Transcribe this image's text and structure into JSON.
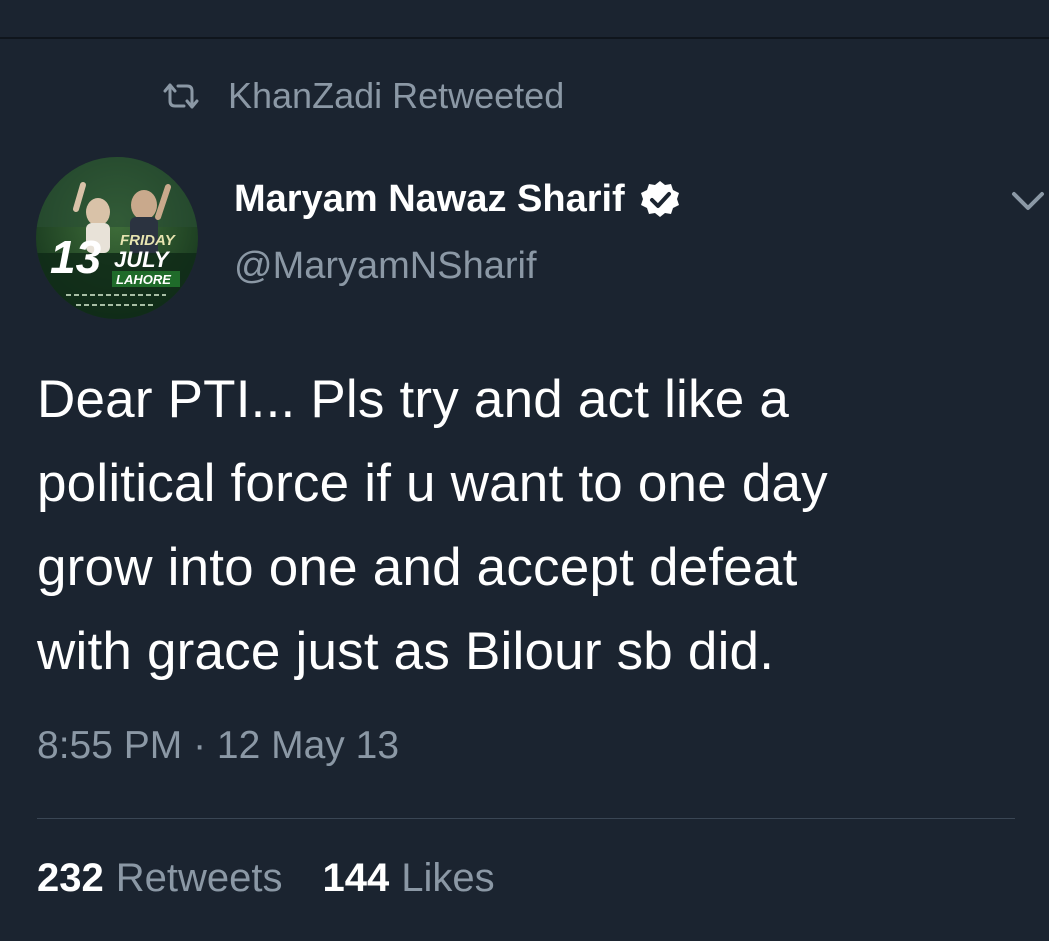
{
  "retweet_context": {
    "icon": "retweet-icon",
    "text": "KhanZadi Retweeted"
  },
  "author": {
    "avatar_badge": {
      "number": "13",
      "line1": "FRIDAY",
      "line2": "JULY",
      "line3": "LAHORE"
    },
    "name": "Maryam Nawaz Sharif",
    "verified_icon": "verified-badge-icon",
    "handle": "@MaryamNSharif"
  },
  "menu_icon": "chevron-down-icon",
  "tweet": {
    "lines": [
      "Dear PTI... Pls try and act like a",
      "political force if u want to one day",
      "grow into one and accept defeat",
      "with grace just as Bilour sb did."
    ],
    "timestamp": "8:55 PM · 12 May 13"
  },
  "stats": {
    "retweets": {
      "count": "232",
      "label": "Retweets"
    },
    "likes": {
      "count": "144",
      "label": "Likes"
    }
  },
  "colors": {
    "background": "#1b2430",
    "text": "#ffffff",
    "secondary_text": "#8b98a5",
    "divider": "#3a4654"
  }
}
